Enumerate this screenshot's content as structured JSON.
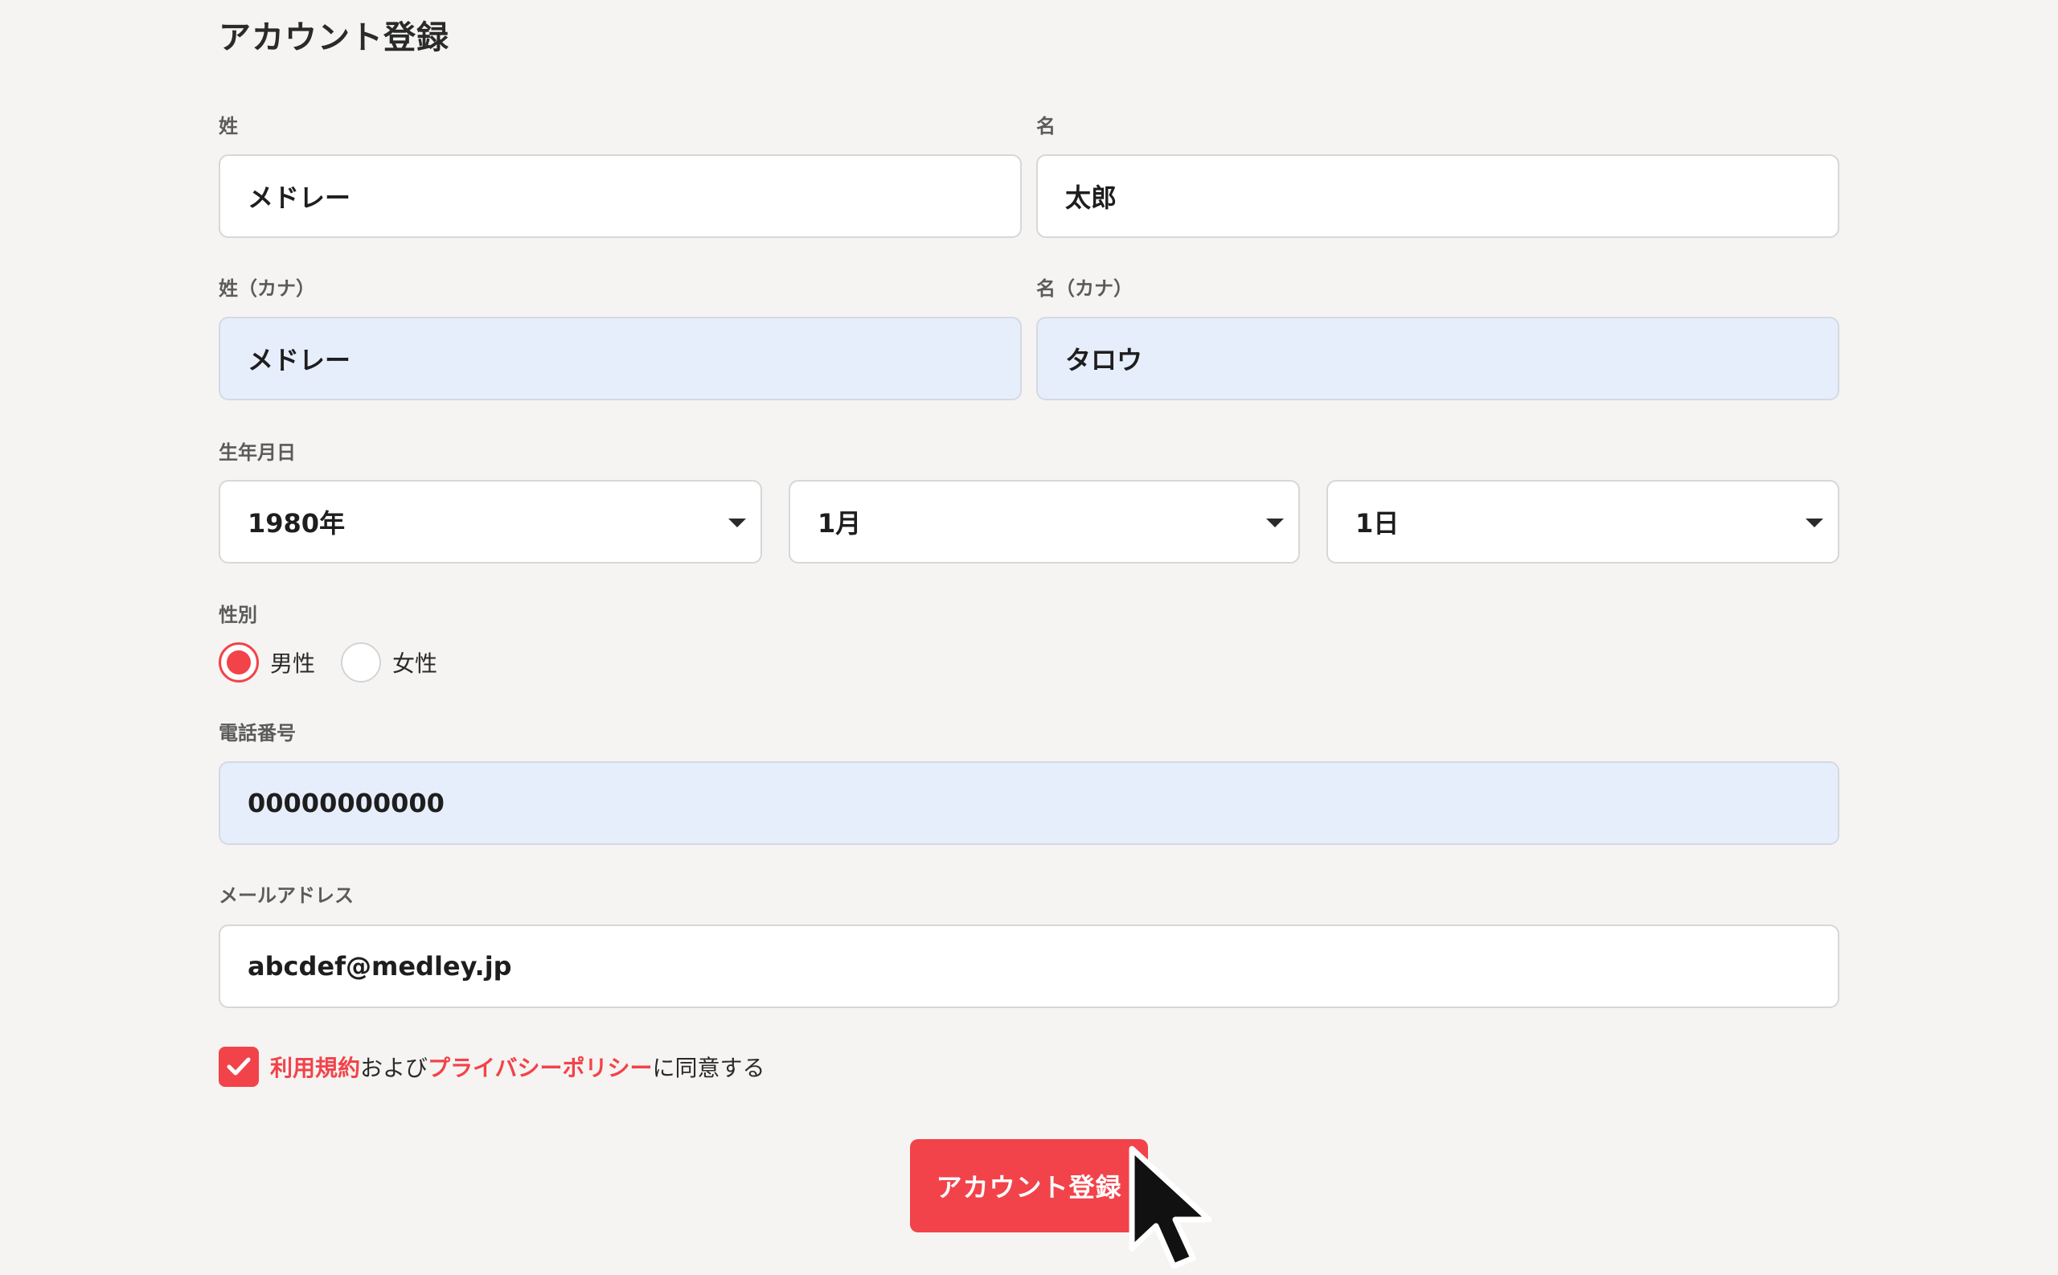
{
  "page": {
    "title": "アカウント登録"
  },
  "form": {
    "last_name": {
      "label": "姓",
      "value": "メドレー"
    },
    "first_name": {
      "label": "名",
      "value": "太郎"
    },
    "last_name_kana": {
      "label": "姓（カナ）",
      "value": "メドレー"
    },
    "first_name_kana": {
      "label": "名（カナ）",
      "value": "タロウ"
    },
    "birthdate": {
      "label": "生年月日",
      "year": "1980年",
      "month": "1月",
      "day": "1日"
    },
    "gender": {
      "label": "性別",
      "options": [
        "男性",
        "女性"
      ],
      "selected": "男性"
    },
    "phone": {
      "label": "電話番号",
      "value": "00000000000"
    },
    "email": {
      "label": "メールアドレス",
      "value": "abcdef@medley.jp"
    },
    "agreement": {
      "checked": true,
      "terms_link": "利用規約",
      "connector": "および",
      "privacy_link": "プライバシーポリシー",
      "suffix": "に同意する"
    },
    "submit_label": "アカウント登録"
  },
  "colors": {
    "accent": "#f2434a",
    "background": "#f5f4f2",
    "autofill": "#e7eefb",
    "text": "#2a2a2a"
  }
}
